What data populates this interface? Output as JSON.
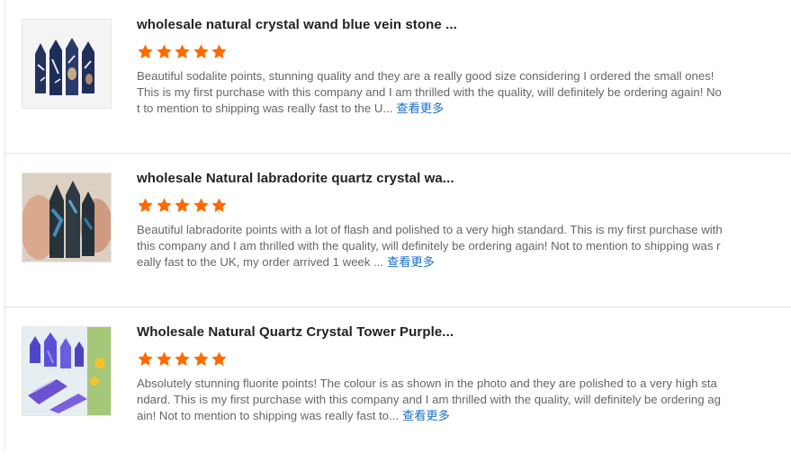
{
  "reviews": [
    {
      "title": "wholesale natural crystal wand blue vein stone ...",
      "rating": 5,
      "text": "Beautiful sodalite points, stunning quality and they are a really good size considering I ordered the small ones! This is my first purchase with this company and I am thrilled with the quality, will definitely be ordering again! Not to mention to shipping was really fast to the U...",
      "more_label": "查看更多",
      "thumb_icon": "sodalite-points-image"
    },
    {
      "title": "wholesale Natural labradorite quartz crystal wa...",
      "rating": 5,
      "text": "Beautiful labradorite points with a lot of flash and polished to a very high standard. This is my first purchase with this company and I am thrilled with the quality, will definitely be ordering again! Not to mention to shipping was really fast to the UK, my order arrived 1 week ...",
      "more_label": "查看更多",
      "thumb_icon": "labradorite-points-image"
    },
    {
      "title": "Wholesale Natural Quartz Crystal Tower Purple...",
      "rating": 5,
      "text": "Absolutely stunning fluorite points! The colour is as shown in the photo and they are polished to a very high standard. This is my first purchase with this company and I am thrilled with the quality, will definitely be ordering again! Not to mention to shipping was really fast to...",
      "more_label": "查看更多",
      "thumb_icon": "fluorite-points-image"
    }
  ],
  "colors": {
    "star": "#ff6a00",
    "link": "#1a6fc4",
    "title": "#222222",
    "body_text": "#666666"
  }
}
